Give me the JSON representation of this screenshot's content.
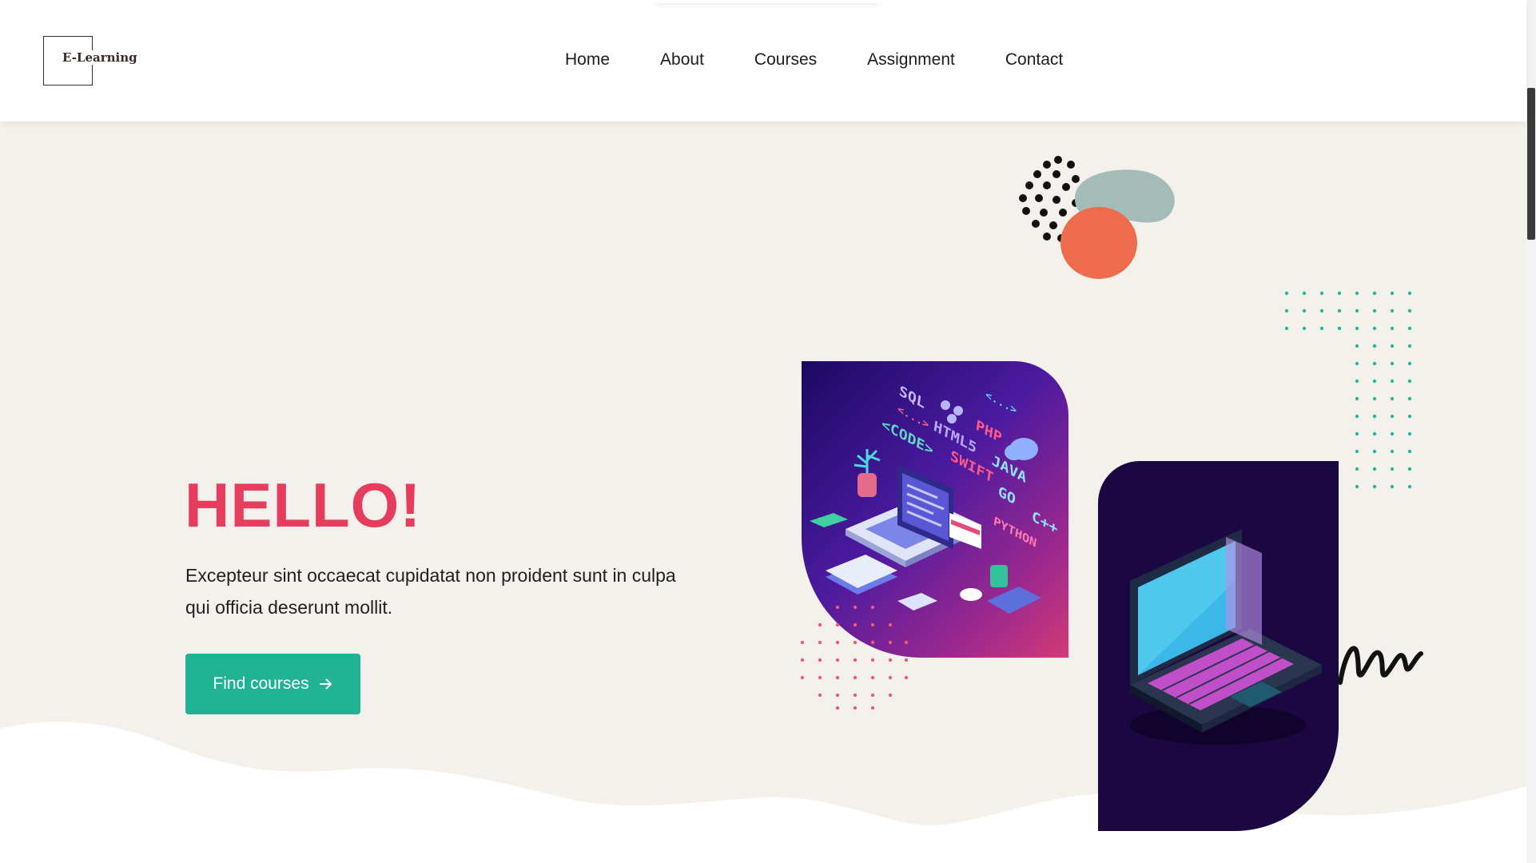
{
  "brand": {
    "logo_text": "E-Learning"
  },
  "nav": {
    "items": [
      {
        "label": "Home"
      },
      {
        "label": "About"
      },
      {
        "label": "Courses"
      },
      {
        "label": "Assignment"
      },
      {
        "label": "Contact"
      }
    ]
  },
  "hero": {
    "title": "HELLO!",
    "description": "Excepteur sint occaecat cupidatat non proident sunt in culpa qui officia deserunt mollit.",
    "cta_label": "Find courses",
    "cta_icon": "arrow-right-icon"
  },
  "illustration": {
    "code_words": [
      "SQL",
      "<...>",
      "<...>",
      "<CODE>",
      "HTML5",
      "PHP",
      "SWIFT",
      "JAVA",
      "GO",
      "C++",
      "PYTHON"
    ]
  },
  "colors": {
    "accent_red": "#e63c5e",
    "accent_green": "#1fb393",
    "hero_background": "#f4f1ec",
    "card_dark": "#1b0842"
  }
}
